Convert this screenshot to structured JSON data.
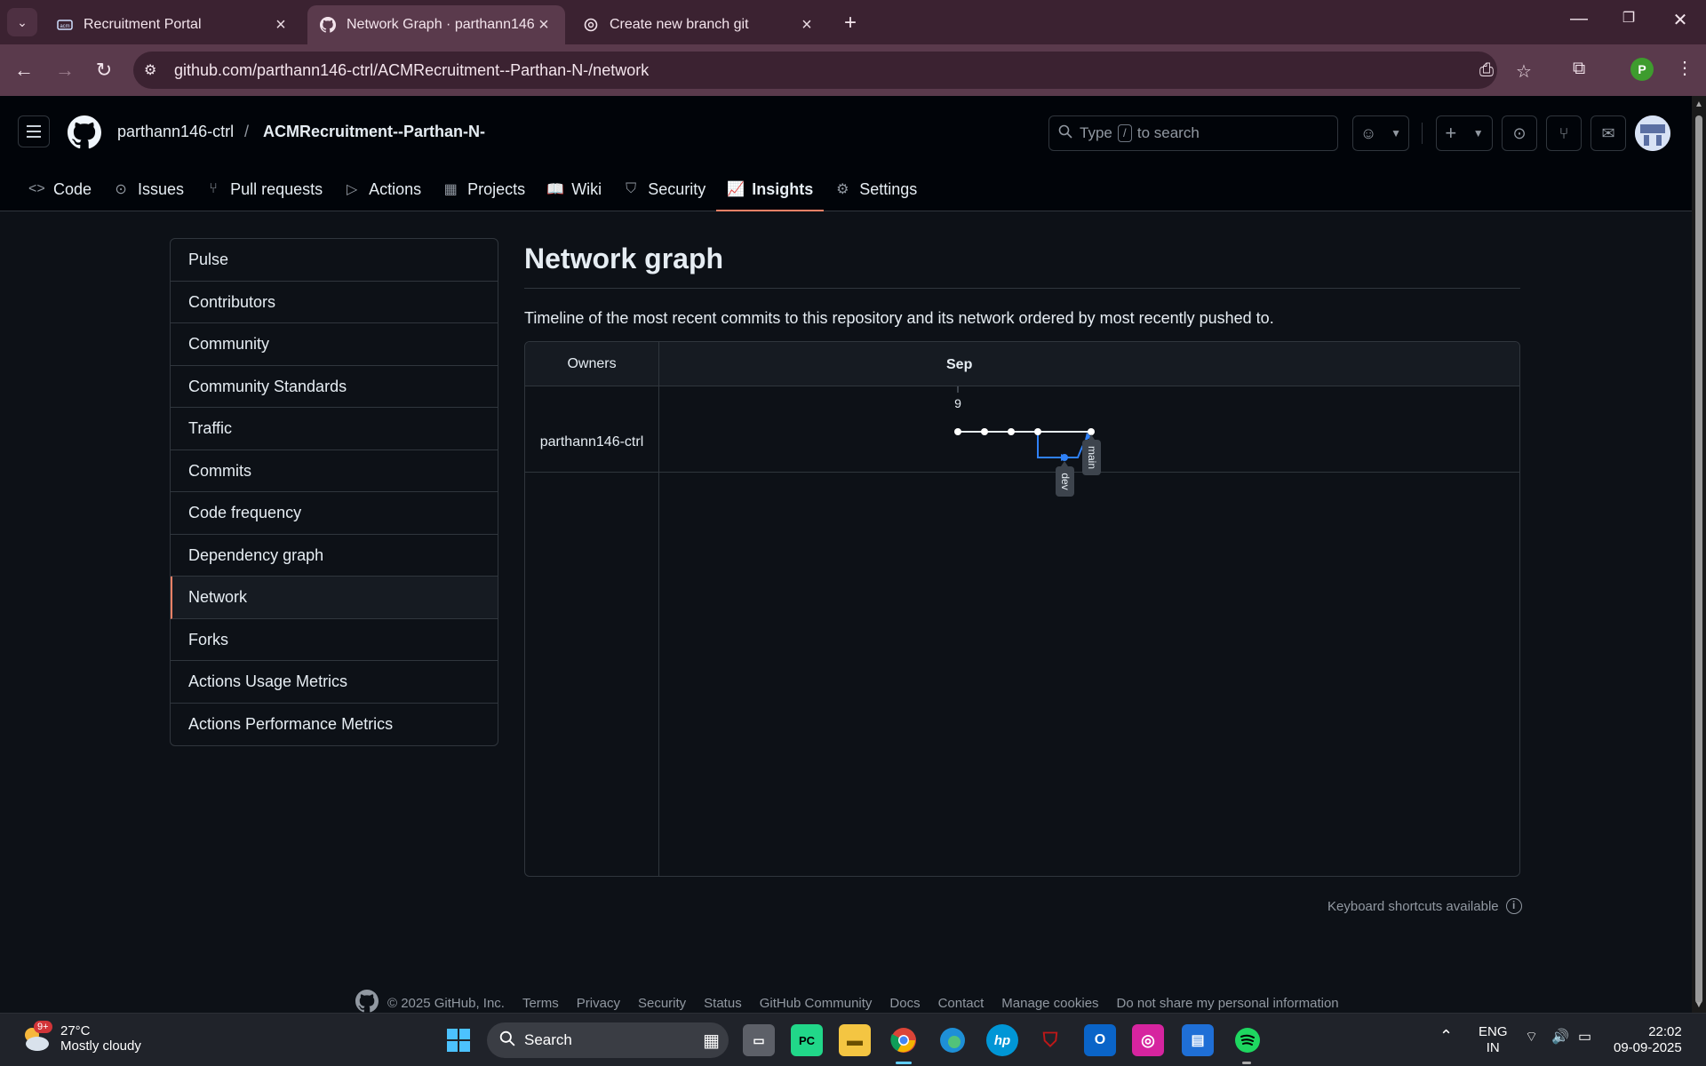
{
  "browser": {
    "tabs": [
      {
        "title": "Recruitment Portal",
        "icon": "acm-icon"
      },
      {
        "title": "Network Graph · parthann146-c",
        "icon": "github-icon"
      },
      {
        "title": "Create new branch git",
        "icon": "chatgpt-icon"
      }
    ],
    "url": "github.com/parthann146-ctrl/ACMRecruitment--Parthan-N-/network",
    "profile_initial": "P"
  },
  "github": {
    "owner": "parthann146-ctrl",
    "separator": "/",
    "repo": "ACMRecruitment--Parthan-N-",
    "search_prefix": "Type",
    "search_key": "/",
    "search_suffix": "to search",
    "nav": [
      "Code",
      "Issues",
      "Pull requests",
      "Actions",
      "Projects",
      "Wiki",
      "Security",
      "Insights",
      "Settings"
    ],
    "active_nav": "Insights"
  },
  "sidebar": {
    "items": [
      "Pulse",
      "Contributors",
      "Community",
      "Community Standards",
      "Traffic",
      "Commits",
      "Code frequency",
      "Dependency graph",
      "Network",
      "Forks",
      "Actions Usage Metrics",
      "Actions Performance Metrics"
    ],
    "selected": "Network"
  },
  "main": {
    "title": "Network graph",
    "description": "Timeline of the most recent commits to this repository and its network ordered by most recently pushed to.",
    "owners_header": "Owners",
    "month": "Sep",
    "day": "9",
    "owner": "parthann146-ctrl",
    "branches": [
      "main",
      "dev"
    ],
    "keyboard_hint": "Keyboard shortcuts available"
  },
  "footer": {
    "copyright": "© 2025 GitHub, Inc.",
    "links": [
      "Terms",
      "Privacy",
      "Security",
      "Status",
      "GitHub Community",
      "Docs",
      "Contact",
      "Manage cookies",
      "Do not share my personal information"
    ]
  },
  "taskbar": {
    "weather_temp": "27°C",
    "weather_desc": "Mostly cloudy",
    "weather_badge": "9+",
    "search_label": "Search",
    "lang_1": "ENG",
    "lang_2": "IN",
    "time": "22:02",
    "date": "09-09-2025"
  },
  "colors": {
    "accent_underline": "#f78166",
    "branch_dev": "#2f81f7",
    "browser_frame": "#5a3a4c"
  }
}
